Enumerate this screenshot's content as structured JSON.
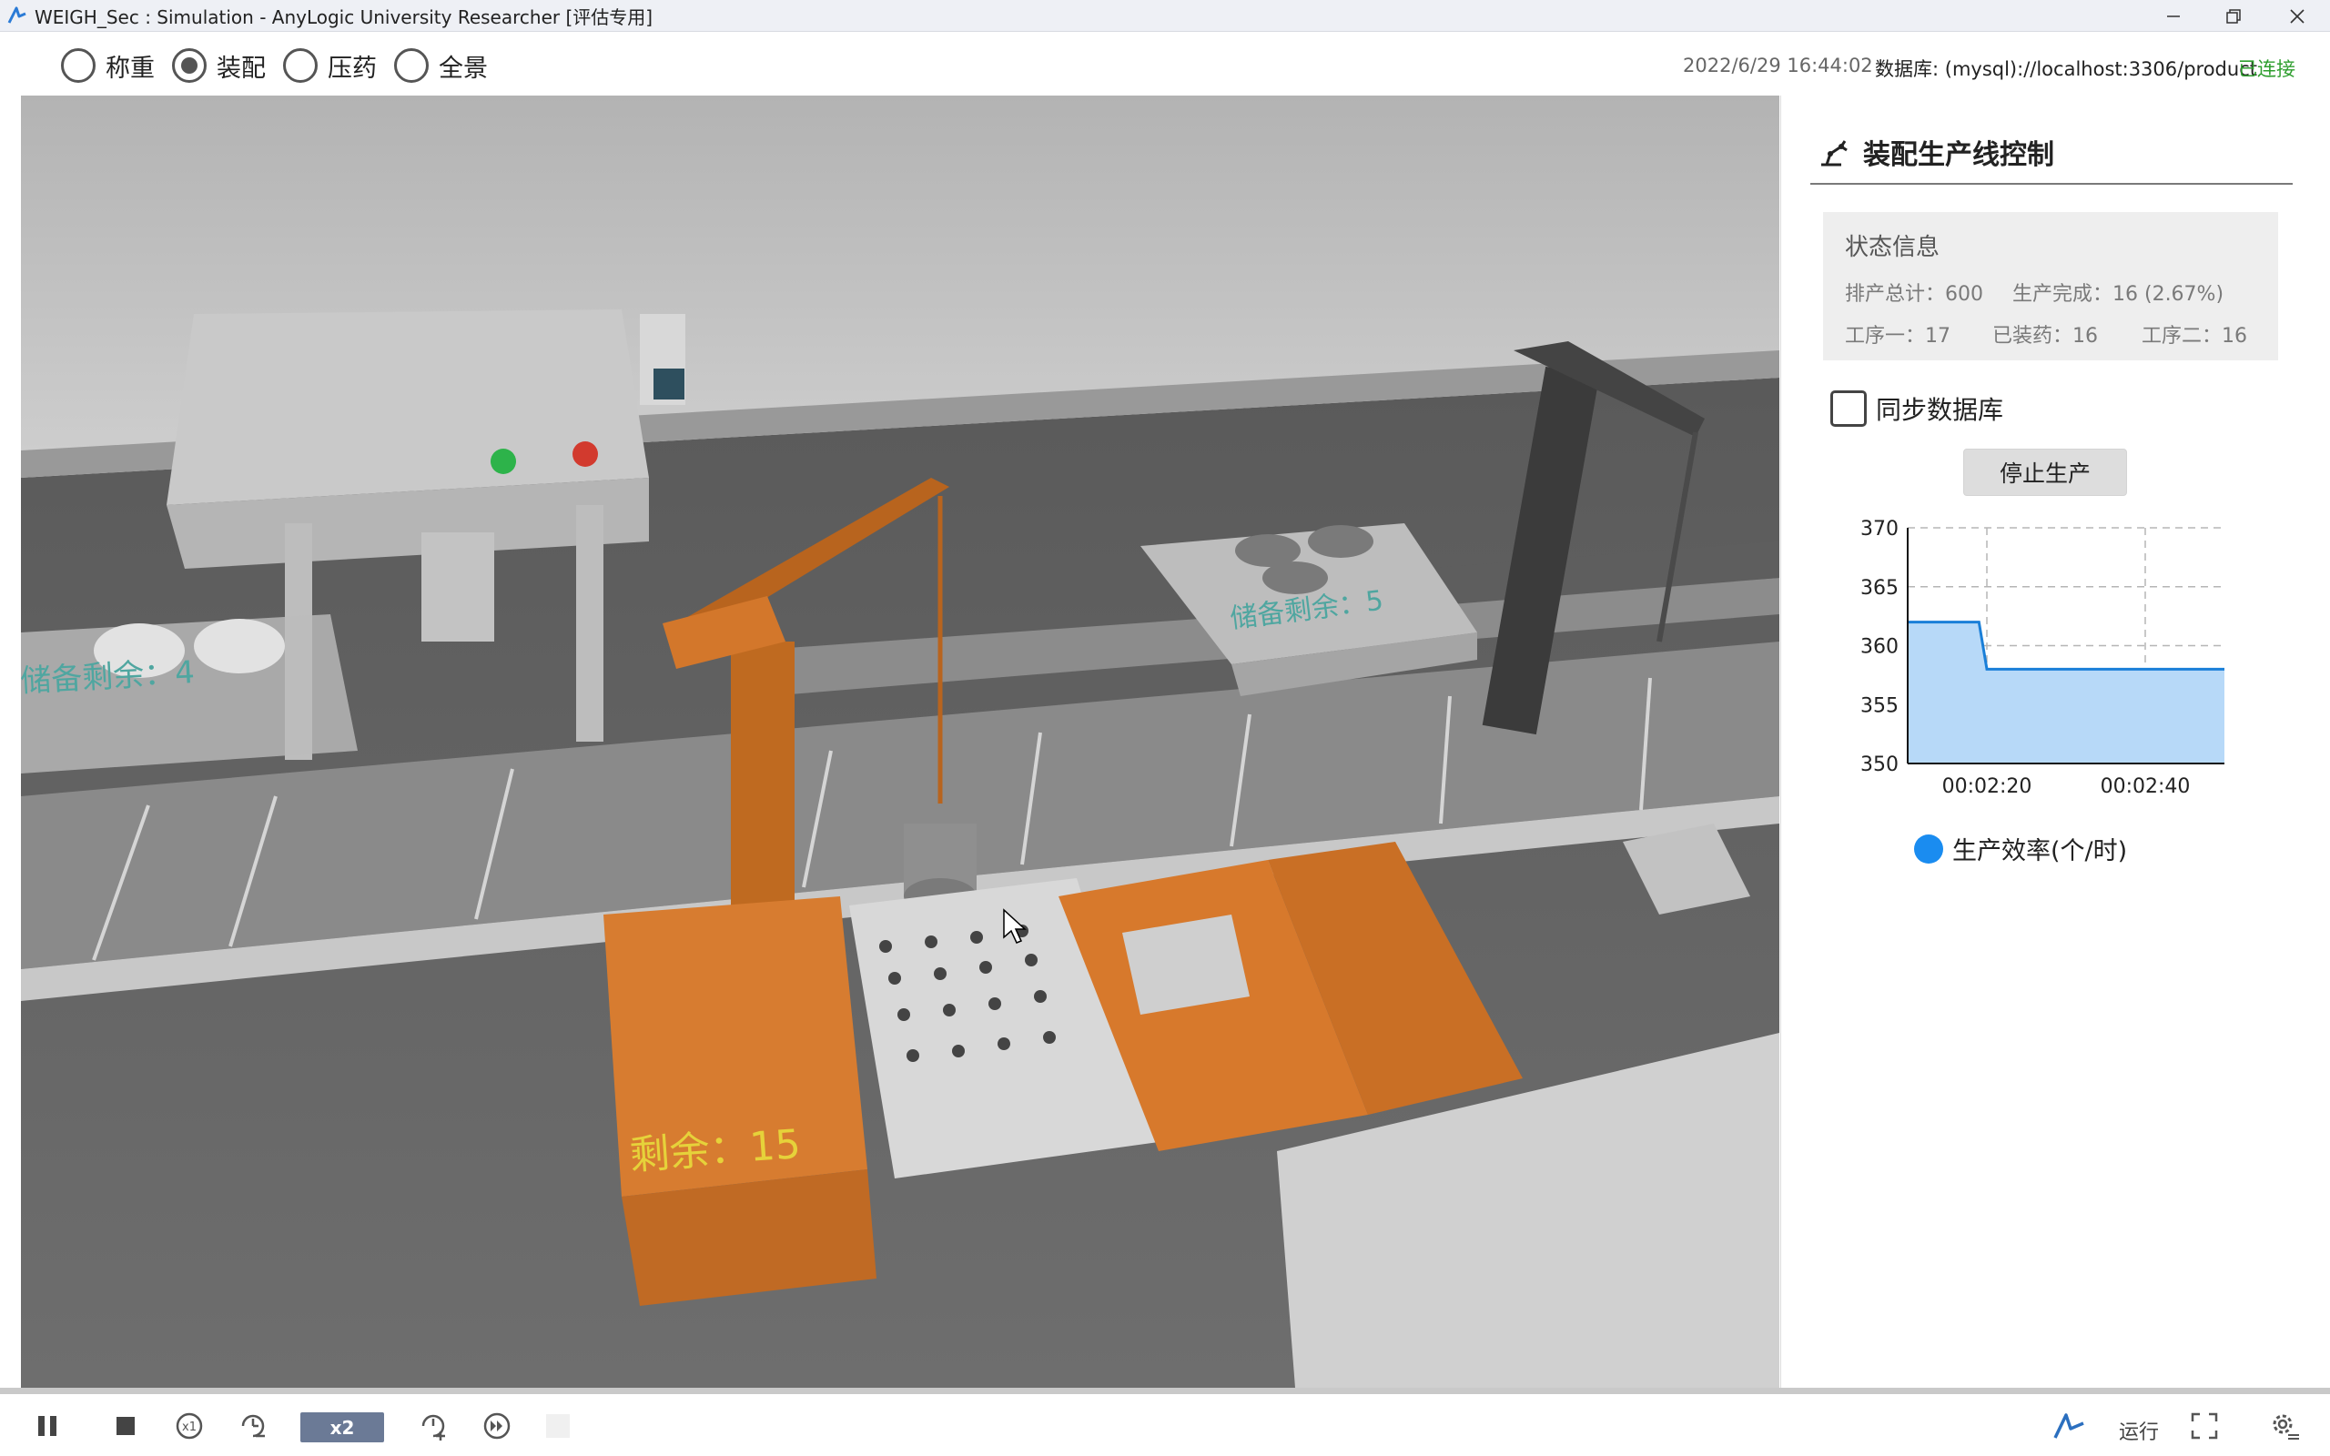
{
  "window": {
    "title": "WEIGH_Sec : Simulation - AnyLogic University Researcher [评估专用]"
  },
  "view_selector": {
    "options": [
      {
        "label": "称重",
        "checked": false
      },
      {
        "label": "装配",
        "checked": true
      },
      {
        "label": "压药",
        "checked": false
      },
      {
        "label": "全景",
        "checked": false
      }
    ]
  },
  "header": {
    "datetime": "2022/6/29 16:44:02",
    "db_label": "数据库: (mysql)://localhost:3306/product",
    "db_status": "已连接",
    "db_status_color": "#2e9e2e"
  },
  "scene": {
    "remaining_label": "剩余：15",
    "left_station_label": "储备剩余：4",
    "right_station_label": "储备剩余：5"
  },
  "panel": {
    "title": "装配生产线控制",
    "status_header": "状态信息",
    "total_label": "排产总计：600",
    "completed_label": "生产完成：16 (2.67%)",
    "process1_label": "工序一：17",
    "loaded_label": "已装药：16",
    "process2_label": "工序二：16",
    "sync_db_label": "同步数据库",
    "sync_db_checked": false,
    "stop_button_label": "停止生产"
  },
  "chart_data": {
    "type": "area",
    "x": [
      "00:02:10",
      "00:02:19",
      "00:02:20",
      "00:02:50"
    ],
    "series": [
      {
        "name": "生产效率(个/时)",
        "values": [
          362,
          362,
          358,
          358
        ]
      }
    ],
    "y_ticks": [
      370,
      365,
      360,
      355,
      350
    ],
    "x_tick_labels": [
      "00:02:20",
      "00:02:40"
    ],
    "ylim": [
      350,
      370
    ],
    "grid": true,
    "legend_position": "bottom",
    "colors": {
      "line": "#1a7fd8",
      "fill": "#b7d9f8",
      "legend": "#1a8cf0"
    }
  },
  "controls": {
    "speed_label": "x2",
    "run_label": "运行",
    "icons": [
      "pause-icon",
      "stop-icon",
      "speed-x1-icon",
      "slower-icon",
      "faster-icon",
      "max-speed-icon",
      "anylogic-logo-icon",
      "fullscreen-icon",
      "settings-icon"
    ]
  }
}
